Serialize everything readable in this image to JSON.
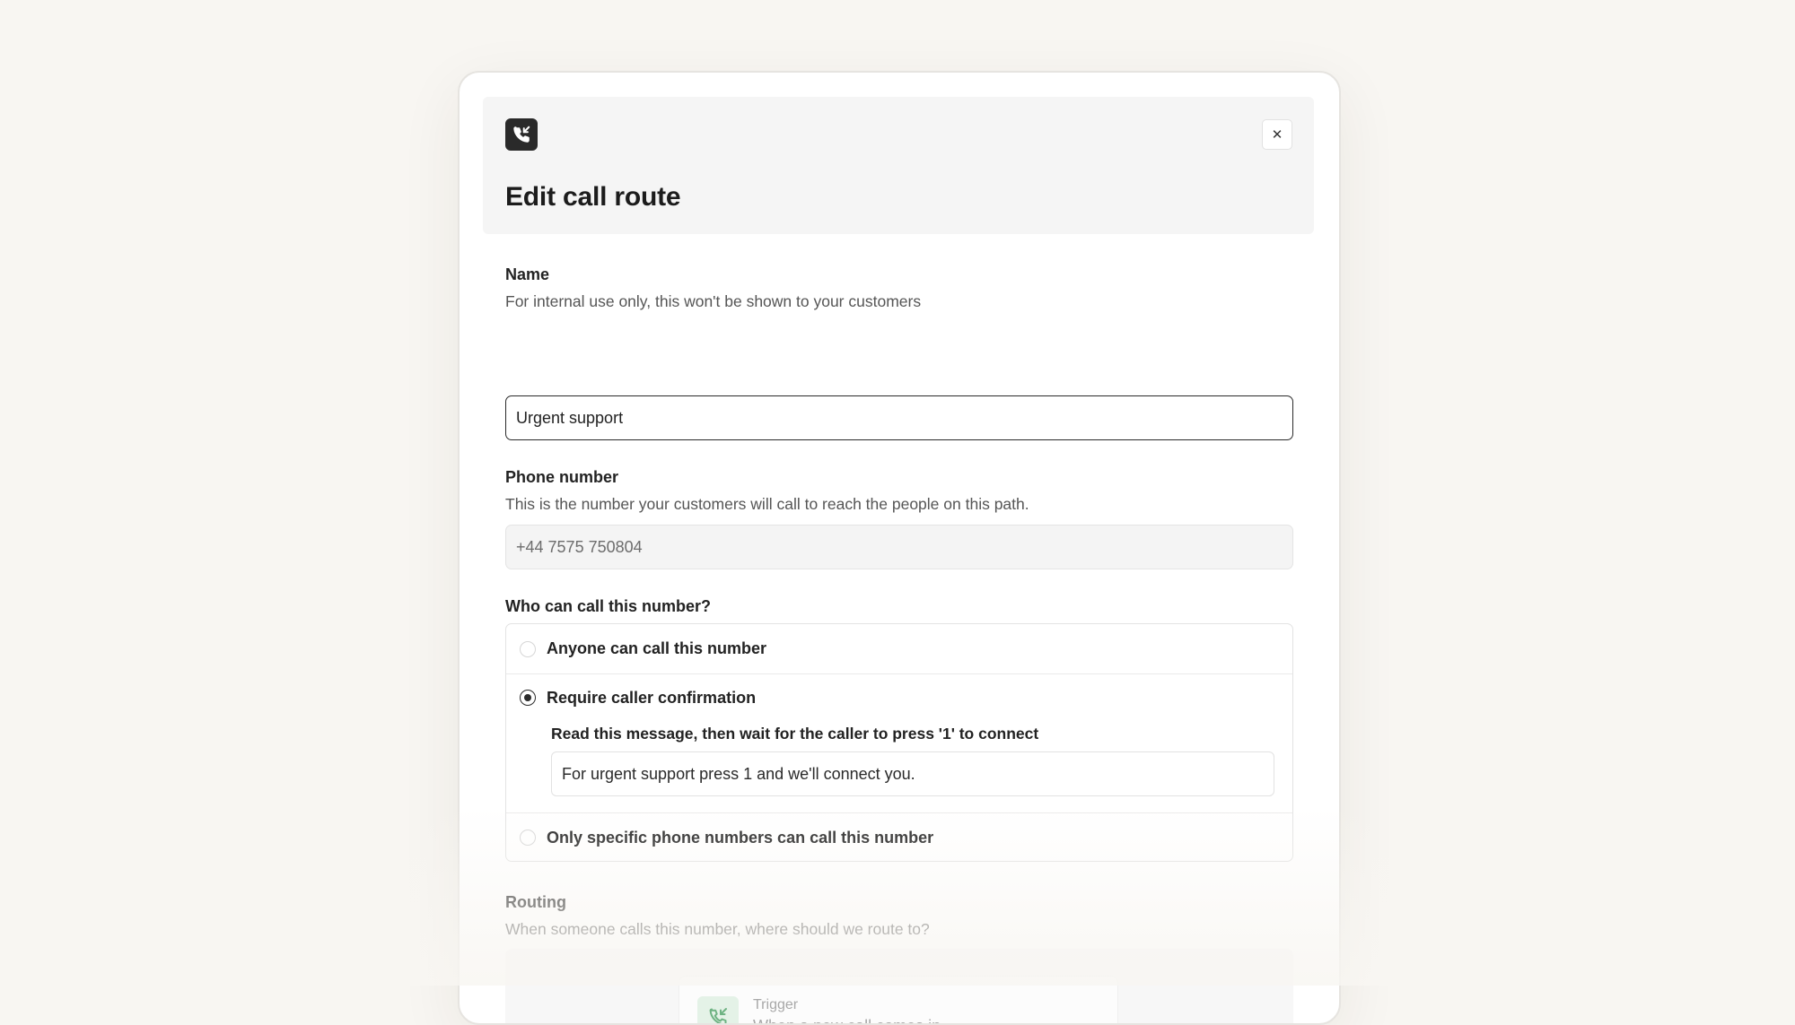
{
  "dialog": {
    "title": "Edit call route",
    "app_icon": "phone-incoming-icon",
    "close_icon": "close-icon",
    "close_glyph": "✕"
  },
  "name_field": {
    "label": "Name",
    "description": "For internal use only, this won't be shown to your customers",
    "value": "Urgent support"
  },
  "phone_field": {
    "label": "Phone number",
    "description": "This is the number your customers will call to reach the people on this path.",
    "value": "+44 7575 750804"
  },
  "who_can_call": {
    "label": "Who can call this number?",
    "options": [
      {
        "label": "Anyone can call this number",
        "checked": false
      },
      {
        "label": "Require caller confirmation",
        "checked": true
      },
      {
        "label": "Only specific phone numbers can call this number",
        "checked": false
      }
    ],
    "confirmation": {
      "label": "Read this message, then wait for the caller to press '1' to connect",
      "value": "For urgent support press 1 and we'll connect you."
    }
  },
  "routing": {
    "label": "Routing",
    "description": "When someone calls this number, where should we route to?",
    "trigger": {
      "icon": "phone-incoming-icon",
      "title": "Trigger",
      "subtitle": "When a new call comes in"
    }
  },
  "colors": {
    "page_background": "#f8f6f2",
    "dark_accent": "#2a2a2a",
    "trigger_icon_bg": "#e4f2e7",
    "trigger_icon_fg": "#6fb383"
  }
}
